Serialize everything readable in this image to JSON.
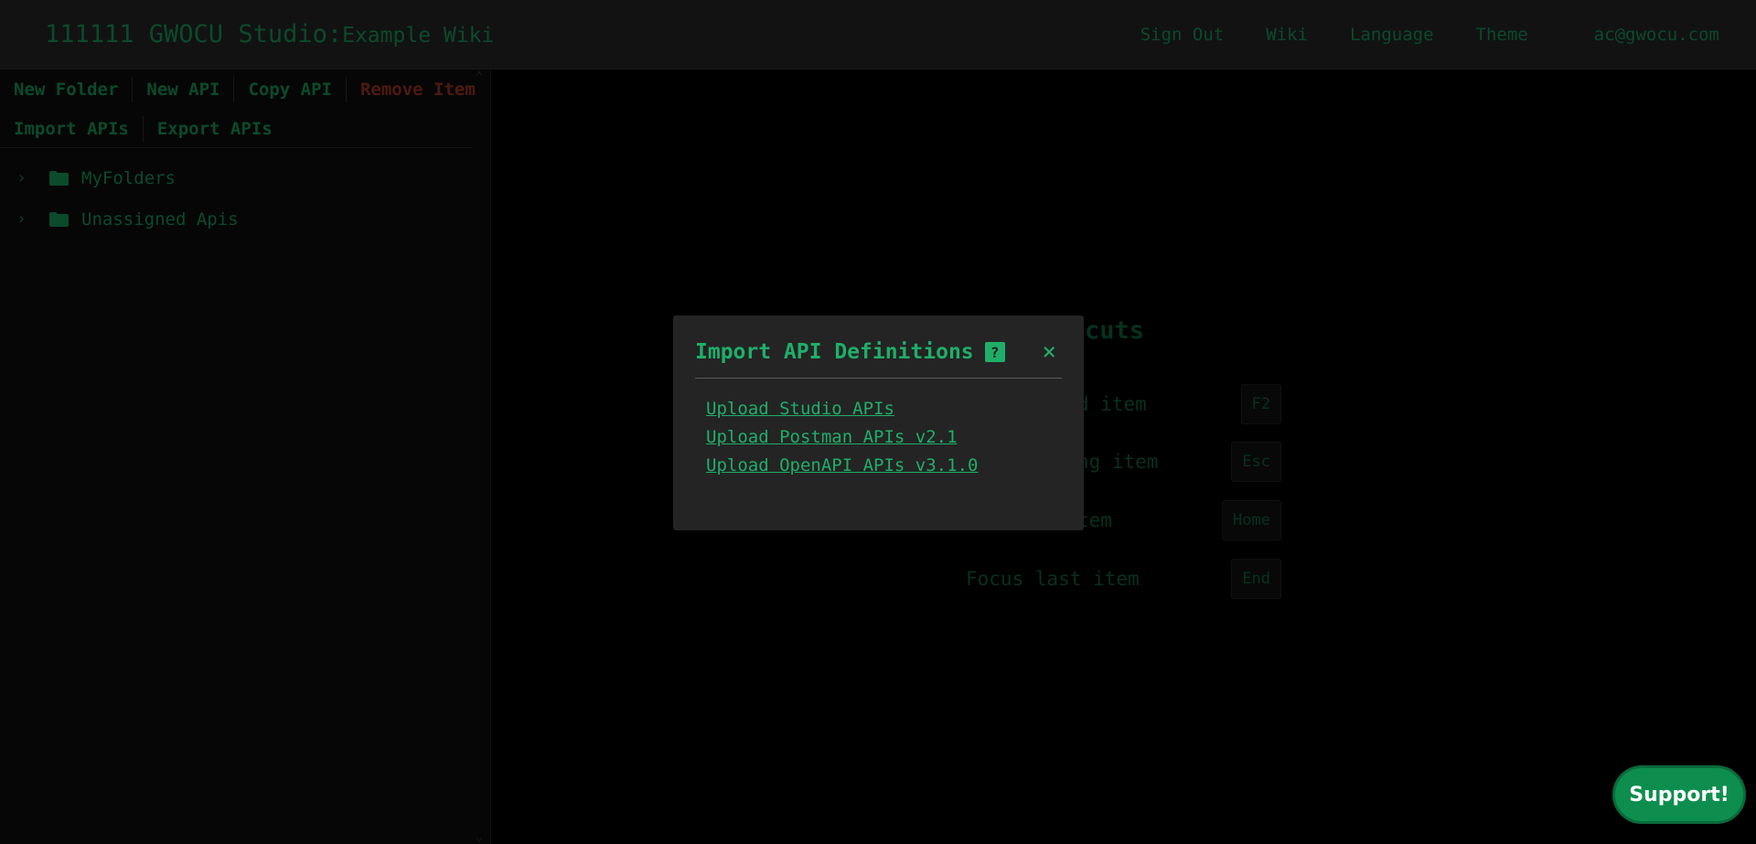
{
  "header": {
    "title": "111111 GWOCU Studio:",
    "subtitle": "Example Wiki",
    "nav": {
      "sign_out": "Sign Out",
      "wiki": "Wiki",
      "language": "Language",
      "theme": "Theme",
      "user_email": "ac@gwocu.com"
    }
  },
  "sidebar": {
    "toolbar_row1": {
      "new_folder": "New Folder",
      "new_api": "New API",
      "copy_api": "Copy API",
      "remove_item": "Remove Item"
    },
    "toolbar_row2": {
      "import_apis": "Import APIs",
      "export_apis": "Export APIs"
    },
    "tree": [
      {
        "label": "MyFolders",
        "icon": "folder-icon"
      },
      {
        "label": "Unassigned Apis",
        "icon": "folder-icon"
      }
    ]
  },
  "shortcuts": {
    "title": "rd shortcuts",
    "rows": [
      {
        "label": "used item",
        "key": "F2"
      },
      {
        "label": "aming item",
        "key": "Esc"
      },
      {
        "label": "t item",
        "key": "Home"
      },
      {
        "label": "Focus last item",
        "key": "End"
      }
    ]
  },
  "modal": {
    "title": "Import API Definitions",
    "help_glyph": "?",
    "close_glyph": "×",
    "links": [
      "Upload Studio APIs",
      "Upload Postman APIs v2.1",
      "Upload OpenAPI APIs v3.1.0"
    ]
  },
  "support": {
    "label": "Support!"
  },
  "colors": {
    "accent": "#1fae69",
    "accent_dim": "#14884f",
    "danger": "#8c2e1f",
    "header_bg": "#212121",
    "sidebar_bg": "#0c0c0c",
    "modal_bg": "#242424",
    "support_bg": "#0d8e4e"
  }
}
